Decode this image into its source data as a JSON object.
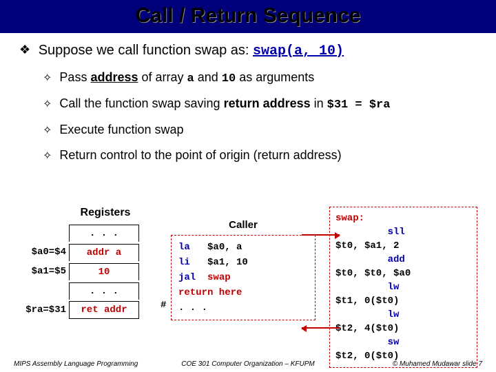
{
  "title": "Call / Return Sequence",
  "topline": {
    "prefix": "Suppose we call function swap as: ",
    "call": "swap(a, 10)"
  },
  "subs": [
    {
      "pre": "Pass ",
      "u1": "address",
      "mid1": " of array ",
      "m1": "a",
      "mid2": " and ",
      "m2": "10",
      "post": " as arguments"
    },
    {
      "pre": "Call the function swap saving ",
      "b1": "return address",
      "mid": " in ",
      "m1": "$31 = $ra"
    },
    {
      "plain": "Execute function swap"
    },
    {
      "plain": "Return control to the point of origin (return address)"
    }
  ],
  "registers": {
    "title": "Registers",
    "rows": [
      {
        "label": "",
        "val": ". . .",
        "black": true
      },
      {
        "label": "$a0=$4",
        "val": "addr a"
      },
      {
        "label": "$a1=$5",
        "val": "10"
      },
      {
        "label": "",
        "val": ". . .",
        "black": true
      },
      {
        "label": "$ra=$31",
        "val": "ret addr",
        "last": true
      }
    ]
  },
  "caller": {
    "title": "Caller",
    "l1a": "la   ",
    "l1b": "$a0, a",
    "l2a": "li   ",
    "l2b": "$a1, 10",
    "l3a": "jal  ",
    "l3b": "swap",
    "l4": "return here",
    "l5": ". . .",
    "hash": "#"
  },
  "callee": {
    "l0": "swap:",
    "l1": "         sll",
    "l2": "$t0, $a1, 2",
    "l3": "         add",
    "l4": "$t0, $t0, $a0",
    "l5": "         lw",
    "l6": "$t1, 0($t0)",
    "l7": "         lw",
    "l8": "$t2, 4($t0)",
    "l9": "         sw",
    "l10": "$t2, 0($t0)"
  },
  "footer": {
    "left": "MIPS Assembly Language Programming",
    "mid": "COE 301 Computer Organization – KFUPM",
    "right": "© Muhamed Mudawar   slide 7"
  }
}
